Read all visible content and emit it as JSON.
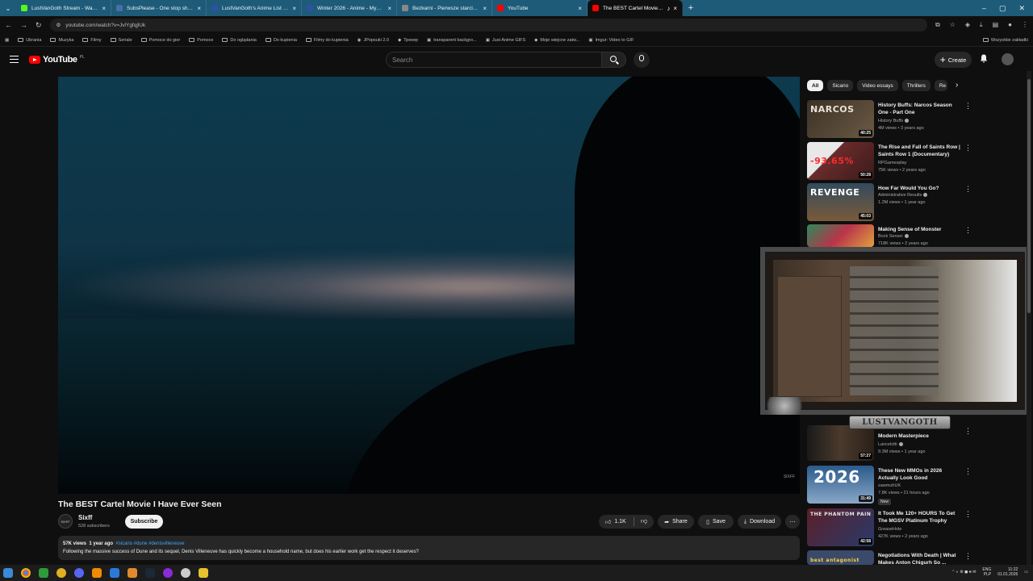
{
  "browser": {
    "tabs": [
      {
        "title": "LustVanGoth Stream - Watch Li",
        "color": "#53fc18"
      },
      {
        "title": "SubsPlease - One stop shop fo",
        "color": "#4a6ea9"
      },
      {
        "title": "LustVanGoth's Anime List - My",
        "color": "#2e51a2"
      },
      {
        "title": "Winter 2026 - Anime - MyAnim",
        "color": "#2e51a2"
      },
      {
        "title": "Bezkarni - Pierwsze starcie / Th",
        "color": "#888888"
      },
      {
        "title": "YouTube",
        "color": "#ff0000"
      },
      {
        "title": "The BEST Cartel Movie I Ha",
        "color": "#ff0000"
      }
    ],
    "url": "youtube.com/watch?v=JvlYgfqjlUk",
    "bookmarks": [
      "Ubrania",
      "Muzyka",
      "Filmy",
      "Seriale",
      "Pomoce do gier",
      "Pomoce",
      "Do oglądania",
      "Do kupienia",
      "Filmy do kupienia",
      "JPopsuki 2.0",
      "Трекер",
      "transparent backgro...",
      "Just Anime GIFS",
      "Moje wiejcne zatw...",
      "Imgur: Video to GIF"
    ],
    "bookmarks_all": "Wszystkie zakładki"
  },
  "header": {
    "logo_text": "YouTube",
    "logo_country": "PL",
    "search_placeholder": "Search",
    "create_label": "Create"
  },
  "video": {
    "title": "The BEST Cartel Movie I Have Ever Seen",
    "watermark": "SIXFF",
    "channel": {
      "avatar_text": "SIXFF",
      "name": "Sixff",
      "subscribers": "528 subscribers"
    },
    "subscribe_label": "Subscribe",
    "likes": "1.1K",
    "share_label": "Share",
    "save_label": "Save",
    "download_label": "Download",
    "views": "57K views",
    "age": "1 year ago",
    "tags": "#sicario #dune #denisvilleneuve",
    "description": "Following the massive success of Dune and its sequel, Denis Villeneuve has quickly become a household name, but does his earlier work get the respect it deserves?"
  },
  "chips": [
    "All",
    "Sicario",
    "Video essays",
    "Thrillers",
    "Re"
  ],
  "recommendations": [
    {
      "title": "History Buffs: Narcos Season One - Part One",
      "channel": "History Buffs",
      "verified": true,
      "meta": "4M views • 3 years ago",
      "duration": "40:25",
      "thumb_text": "NARCOS",
      "thumb_bg": "#3b3126",
      "thumb_fg": "#e8e2d4"
    },
    {
      "title": "The Rise and Fall of Saints Row | Saints Row 1 (Documentary)",
      "channel": "RPGamesplay",
      "verified": false,
      "meta": "75K views • 2 years ago",
      "duration": "50:28",
      "thumb_text": "-93.65%",
      "thumb_bg": "#6a2b2b",
      "thumb_fg": "#ff2a2a"
    },
    {
      "title": "How Far Would You Go?",
      "channel": "Administrative Results",
      "verified": true,
      "meta": "1.2M views • 1 year ago",
      "duration": "45:03",
      "thumb_text": "REVENGE",
      "thumb_bg": "#324a5c",
      "thumb_fg": "#ffffff"
    },
    {
      "title": "Making Sense of Monster",
      "channel": "Bock Sensei",
      "verified": true,
      "meta": "718K views • 2 years ago",
      "duration": "",
      "thumb_text": "",
      "thumb_bg": "#b8344a",
      "thumb_fg": "#ffffff"
    },
    {
      "title": "Modern Masterpiece",
      "channel": "Lancelotti",
      "verified": true,
      "meta": "9.3M views • 1 year ago",
      "duration": "57:27",
      "thumb_text": "",
      "thumb_bg": "#4a3a2c",
      "thumb_fg": "#ffffff"
    },
    {
      "title": "These New MMOs in 2026 Actually Look Good",
      "channel": "zawmuhUK",
      "verified": false,
      "meta": "7.8K views • 21 hours ago",
      "duration": "31:49",
      "badge": "New",
      "thumb_text": "2026",
      "thumb_bg": "#2a5a8a",
      "thumb_fg": "#ffffff"
    },
    {
      "title": "It Took Me 120+ HOURS To Get The MGSV Platinum Trophy",
      "channel": "GreaseHole",
      "verified": false,
      "meta": "427K views • 2 years ago",
      "duration": "42:58",
      "thumb_text": "THE PHANTOM PAIN",
      "thumb_bg": "#5a1f2a",
      "thumb_fg": "#e8e8e8"
    },
    {
      "title": "Negotiations With Death | What Makes Anton Chigurh So ...",
      "channel": "",
      "verified": false,
      "meta": "",
      "duration": "",
      "thumb_text": "best antagonist",
      "thumb_bg": "#3a4a6a",
      "thumb_fg": "#ffd23a"
    }
  ],
  "stream_overlay": {
    "name": "LUSTVANGOTH"
  },
  "taskbar": {
    "lang": "ENG",
    "lang_sub": "PLP",
    "time": "11:22",
    "date": "01.01.2026"
  }
}
